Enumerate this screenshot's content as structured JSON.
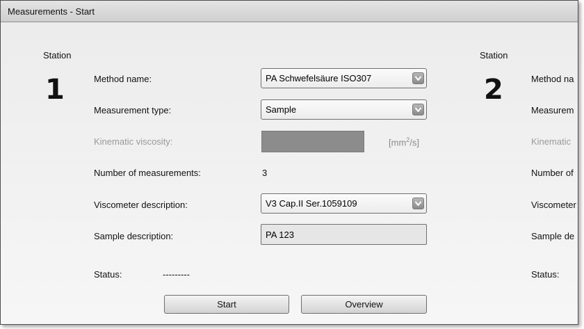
{
  "window": {
    "title": "Measurements - Start"
  },
  "station1": {
    "label": "Station",
    "number": "1",
    "method_label": "Method name:",
    "method_value": "PA Schwefelsäure ISO307",
    "type_label": "Measurement type:",
    "type_value": "Sample",
    "viscosity_label": "Kinematic viscosity:",
    "viscosity_unit_prefix": "[mm",
    "viscosity_unit_sup": "2",
    "viscosity_unit_suffix": "/s]",
    "count_label": "Number of measurements:",
    "count_value": "3",
    "viscometer_label": "Viscometer description:",
    "viscometer_value": "V3 Cap.II Ser.1059109",
    "sample_label": "Sample description:",
    "sample_value": "PA 123",
    "status_label": "Status:",
    "status_value": "---------",
    "start_button": "Start",
    "overview_button": "Overview"
  },
  "station2": {
    "label": "Station",
    "number": "2",
    "method_label": "Method na",
    "type_label": "Measurem",
    "viscosity_label": "Kinematic",
    "count_label": "Number of",
    "viscometer_label": "Viscometer",
    "sample_label": "Sample de",
    "status_label": "Status:"
  },
  "icons": {
    "dropdown": "chevron-down-icon"
  },
  "colors": {
    "disabled_field": "#8c8c8c",
    "disabled_text": "#9a9a9a"
  }
}
